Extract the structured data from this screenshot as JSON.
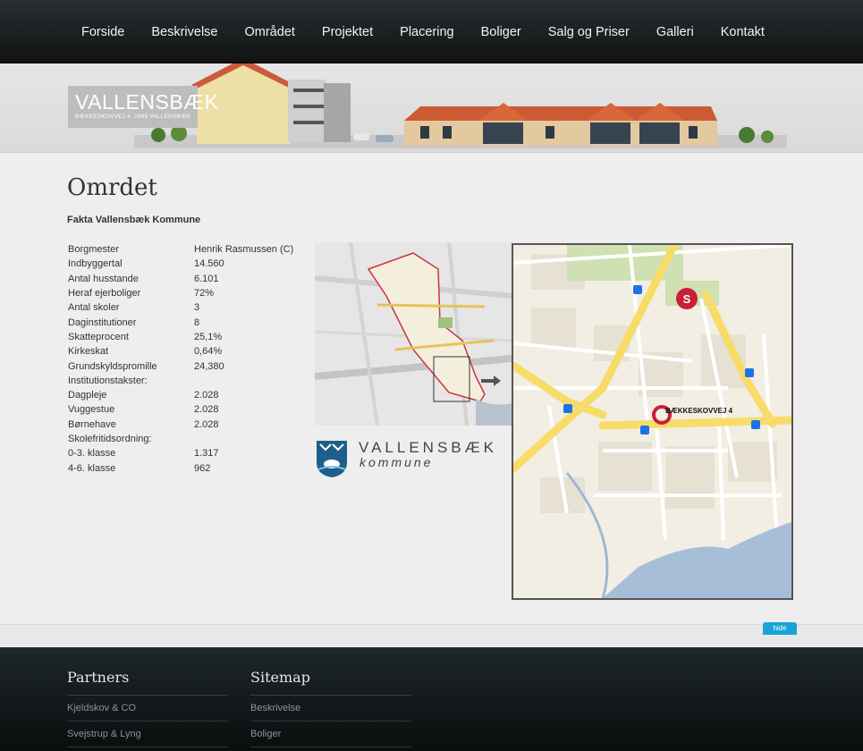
{
  "nav": {
    "items": [
      "Forside",
      "Beskrivelse",
      "Området",
      "Projektet",
      "Placering",
      "Boliger",
      "Salg og Priser",
      "Galleri",
      "Kontakt"
    ]
  },
  "banner": {
    "logo_title": "VALLENSBÆK",
    "logo_subtitle": "BÆKKESKOVVEJ 4, 2665 VALLENSBÆK"
  },
  "content": {
    "title": "Omrdet",
    "subheading": "Fakta Vallensbæk Kommune",
    "facts": [
      {
        "k": "Borgmester",
        "v": "Henrik Rasmussen (C)"
      },
      {
        "k": "Indbyggertal",
        "v": "14.560"
      },
      {
        "k": "Antal husstande",
        "v": "6.101"
      },
      {
        "k": "Heraf ejerboliger",
        "v": "72%"
      },
      {
        "k": "Antal skoler",
        "v": "3"
      },
      {
        "k": "Daginstitutioner",
        "v": "8"
      },
      {
        "k": "Skatteprocent",
        "v": "25,1%"
      },
      {
        "k": "Kirkeskat",
        "v": "0,64%"
      },
      {
        "k": "Grundskyldspromille",
        "v": "24,380"
      },
      {
        "k": "Institutionstakster:",
        "v": ""
      },
      {
        "k": "Dagpleje",
        "v": "2.028"
      },
      {
        "k": "Vuggestue",
        "v": "2.028"
      },
      {
        "k": "Børnehave",
        "v": "2.028"
      },
      {
        "k": "Skolefritidsordning:",
        "v": ""
      },
      {
        "k": "0-3. klasse",
        "v": "1.317"
      },
      {
        "k": "4-6. klasse",
        "v": "962"
      }
    ],
    "municipality_logo": {
      "name": "VALLENSBÆK",
      "sub": "kommune"
    },
    "map_marker_label": "BÆKKESKOVVEJ 4",
    "hide_label": "hide"
  },
  "footer": {
    "partners": {
      "title": "Partners",
      "links": [
        "Kjeldskov & CO",
        "Svejstrup & Lyng"
      ]
    },
    "sitemap": {
      "title": "Sitemap",
      "links": [
        "Beskrivelse",
        "Boliger"
      ]
    }
  },
  "colors": {
    "nav_bg": "#1a1d1e",
    "footer_bg": "#111617",
    "hide_button": "#1aa3d9",
    "map_road": "#f7dc6a",
    "marker_red": "#c8203a"
  }
}
